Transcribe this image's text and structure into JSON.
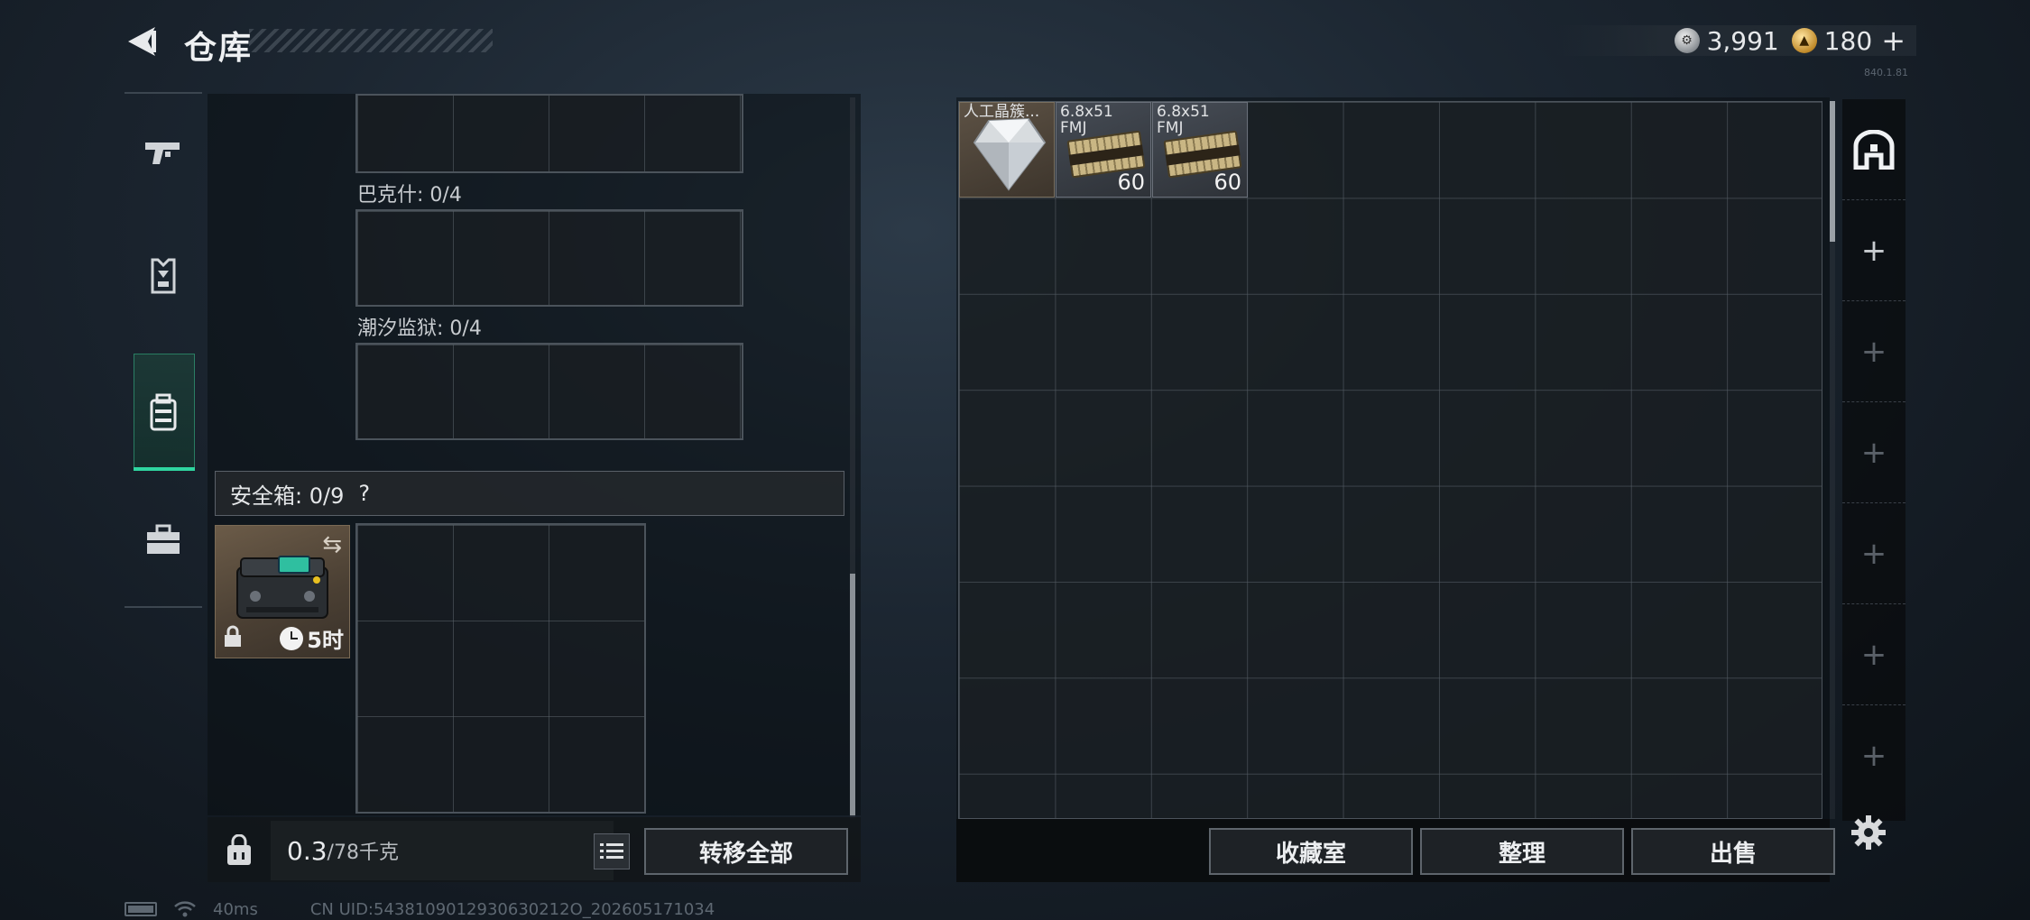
{
  "header": {
    "title": "仓库",
    "build_tag": "840.1.81",
    "currencies": [
      {
        "name": "silver-coin",
        "value": "3,991",
        "color": "#a8adb2"
      },
      {
        "name": "gold-coin",
        "value": "180",
        "color": "#c8922e"
      }
    ],
    "add_label": "+"
  },
  "side_tabs": [
    {
      "icon": "pistol-icon"
    },
    {
      "icon": "armor-vest-icon"
    },
    {
      "icon": "backpack-icon",
      "selected": true
    },
    {
      "icon": "briefcase-icon"
    }
  ],
  "left_panel": {
    "slots": [
      {
        "label": ""
      },
      {
        "label": "巴克什: 0/4"
      },
      {
        "label": "潮汐监狱: 0/4"
      }
    ],
    "safe_box": {
      "label": "安全箱:",
      "count": "0/9",
      "help": "?",
      "timer": "5时",
      "accent": "#2fd6a0"
    }
  },
  "left_bottom": {
    "weight_current": "0.3",
    "weight_max": "/78千克",
    "transfer_all": "转移全部"
  },
  "stash": {
    "items": [
      {
        "name": "人工晶簇...",
        "count": "",
        "type": "crystal"
      },
      {
        "name": "6.8x51\nFMJ",
        "count": "60",
        "type": "ammo"
      },
      {
        "name": "6.8x51\nFMJ",
        "count": "60",
        "type": "ammo"
      }
    ]
  },
  "right_tabs": [
    "stash-home-icon",
    "+",
    "+",
    "+",
    "+",
    "+",
    "+"
  ],
  "actions": {
    "collection": "收藏室",
    "organize": "整理",
    "sell": "出售"
  },
  "status": {
    "ping": "40ms",
    "uid": "CN UID:5438109012930630212O_202605171034"
  }
}
